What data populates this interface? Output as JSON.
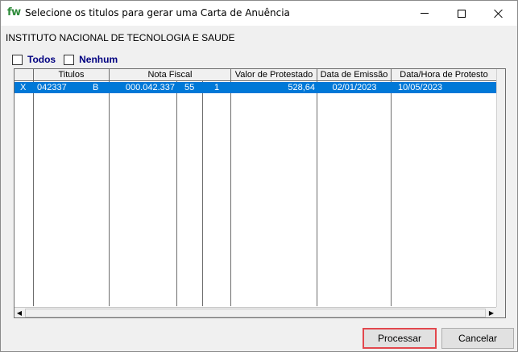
{
  "window": {
    "app_icon": "fw",
    "title": "Selecione os titulos para gerar uma Carta de Anuência"
  },
  "company": "INSTITUTO NACIONAL DE TECNOLOGIA E SAUDE",
  "select_all": {
    "todos_label": "Todos",
    "nenhum_label": "Nenhum",
    "todos_checked": false,
    "nenhum_checked": false
  },
  "grid": {
    "headers": {
      "titulos": "Titulos",
      "nota_fiscal": "Nota Fiscal",
      "valor_protestado": "Valor de Protestado",
      "data_emissao": "Data de Emissão",
      "data_hora_protesto": "Data/Hora de Protesto"
    },
    "rows": [
      {
        "mark": "X",
        "titulo": "042337",
        "parcela": "B",
        "nota_fiscal": "000.042.337",
        "serie": "55",
        "seq": "1",
        "valor_protestado": "528,64",
        "data_emissao": "02/01/2023",
        "data_hora_protesto": "10/05/2023"
      }
    ]
  },
  "buttons": {
    "processar": "Processar",
    "cancelar": "Cancelar"
  },
  "icons": {
    "minimize": "minimize-icon",
    "maximize": "maximize-icon",
    "close": "close-icon",
    "scroll_left": "arrow-left-icon",
    "scroll_right": "arrow-right-icon"
  }
}
